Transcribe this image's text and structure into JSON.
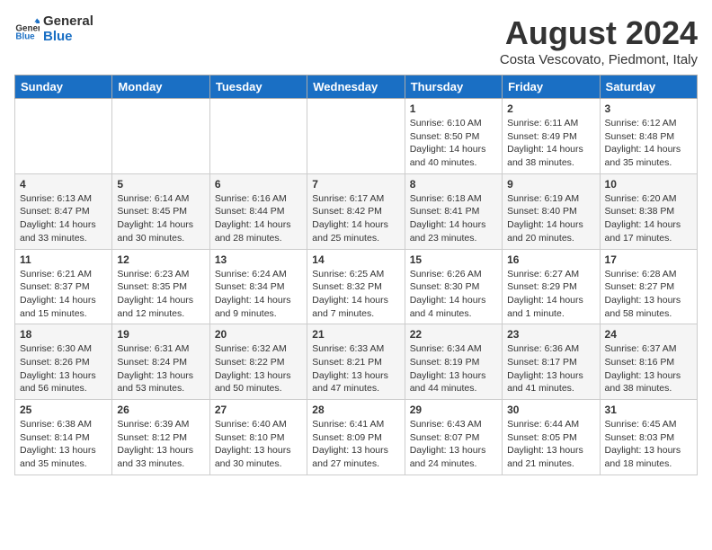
{
  "logo": {
    "line1": "General",
    "line2": "Blue"
  },
  "title": "August 2024",
  "subtitle": "Costa Vescovato, Piedmont, Italy",
  "weekdays": [
    "Sunday",
    "Monday",
    "Tuesday",
    "Wednesday",
    "Thursday",
    "Friday",
    "Saturday"
  ],
  "weeks": [
    [
      {
        "day": "",
        "info": ""
      },
      {
        "day": "",
        "info": ""
      },
      {
        "day": "",
        "info": ""
      },
      {
        "day": "",
        "info": ""
      },
      {
        "day": "1",
        "info": "Sunrise: 6:10 AM\nSunset: 8:50 PM\nDaylight: 14 hours\nand 40 minutes."
      },
      {
        "day": "2",
        "info": "Sunrise: 6:11 AM\nSunset: 8:49 PM\nDaylight: 14 hours\nand 38 minutes."
      },
      {
        "day": "3",
        "info": "Sunrise: 6:12 AM\nSunset: 8:48 PM\nDaylight: 14 hours\nand 35 minutes."
      }
    ],
    [
      {
        "day": "4",
        "info": "Sunrise: 6:13 AM\nSunset: 8:47 PM\nDaylight: 14 hours\nand 33 minutes."
      },
      {
        "day": "5",
        "info": "Sunrise: 6:14 AM\nSunset: 8:45 PM\nDaylight: 14 hours\nand 30 minutes."
      },
      {
        "day": "6",
        "info": "Sunrise: 6:16 AM\nSunset: 8:44 PM\nDaylight: 14 hours\nand 28 minutes."
      },
      {
        "day": "7",
        "info": "Sunrise: 6:17 AM\nSunset: 8:42 PM\nDaylight: 14 hours\nand 25 minutes."
      },
      {
        "day": "8",
        "info": "Sunrise: 6:18 AM\nSunset: 8:41 PM\nDaylight: 14 hours\nand 23 minutes."
      },
      {
        "day": "9",
        "info": "Sunrise: 6:19 AM\nSunset: 8:40 PM\nDaylight: 14 hours\nand 20 minutes."
      },
      {
        "day": "10",
        "info": "Sunrise: 6:20 AM\nSunset: 8:38 PM\nDaylight: 14 hours\nand 17 minutes."
      }
    ],
    [
      {
        "day": "11",
        "info": "Sunrise: 6:21 AM\nSunset: 8:37 PM\nDaylight: 14 hours\nand 15 minutes."
      },
      {
        "day": "12",
        "info": "Sunrise: 6:23 AM\nSunset: 8:35 PM\nDaylight: 14 hours\nand 12 minutes."
      },
      {
        "day": "13",
        "info": "Sunrise: 6:24 AM\nSunset: 8:34 PM\nDaylight: 14 hours\nand 9 minutes."
      },
      {
        "day": "14",
        "info": "Sunrise: 6:25 AM\nSunset: 8:32 PM\nDaylight: 14 hours\nand 7 minutes."
      },
      {
        "day": "15",
        "info": "Sunrise: 6:26 AM\nSunset: 8:30 PM\nDaylight: 14 hours\nand 4 minutes."
      },
      {
        "day": "16",
        "info": "Sunrise: 6:27 AM\nSunset: 8:29 PM\nDaylight: 14 hours\nand 1 minute."
      },
      {
        "day": "17",
        "info": "Sunrise: 6:28 AM\nSunset: 8:27 PM\nDaylight: 13 hours\nand 58 minutes."
      }
    ],
    [
      {
        "day": "18",
        "info": "Sunrise: 6:30 AM\nSunset: 8:26 PM\nDaylight: 13 hours\nand 56 minutes."
      },
      {
        "day": "19",
        "info": "Sunrise: 6:31 AM\nSunset: 8:24 PM\nDaylight: 13 hours\nand 53 minutes."
      },
      {
        "day": "20",
        "info": "Sunrise: 6:32 AM\nSunset: 8:22 PM\nDaylight: 13 hours\nand 50 minutes."
      },
      {
        "day": "21",
        "info": "Sunrise: 6:33 AM\nSunset: 8:21 PM\nDaylight: 13 hours\nand 47 minutes."
      },
      {
        "day": "22",
        "info": "Sunrise: 6:34 AM\nSunset: 8:19 PM\nDaylight: 13 hours\nand 44 minutes."
      },
      {
        "day": "23",
        "info": "Sunrise: 6:36 AM\nSunset: 8:17 PM\nDaylight: 13 hours\nand 41 minutes."
      },
      {
        "day": "24",
        "info": "Sunrise: 6:37 AM\nSunset: 8:16 PM\nDaylight: 13 hours\nand 38 minutes."
      }
    ],
    [
      {
        "day": "25",
        "info": "Sunrise: 6:38 AM\nSunset: 8:14 PM\nDaylight: 13 hours\nand 35 minutes."
      },
      {
        "day": "26",
        "info": "Sunrise: 6:39 AM\nSunset: 8:12 PM\nDaylight: 13 hours\nand 33 minutes."
      },
      {
        "day": "27",
        "info": "Sunrise: 6:40 AM\nSunset: 8:10 PM\nDaylight: 13 hours\nand 30 minutes."
      },
      {
        "day": "28",
        "info": "Sunrise: 6:41 AM\nSunset: 8:09 PM\nDaylight: 13 hours\nand 27 minutes."
      },
      {
        "day": "29",
        "info": "Sunrise: 6:43 AM\nSunset: 8:07 PM\nDaylight: 13 hours\nand 24 minutes."
      },
      {
        "day": "30",
        "info": "Sunrise: 6:44 AM\nSunset: 8:05 PM\nDaylight: 13 hours\nand 21 minutes."
      },
      {
        "day": "31",
        "info": "Sunrise: 6:45 AM\nSunset: 8:03 PM\nDaylight: 13 hours\nand 18 minutes."
      }
    ]
  ]
}
